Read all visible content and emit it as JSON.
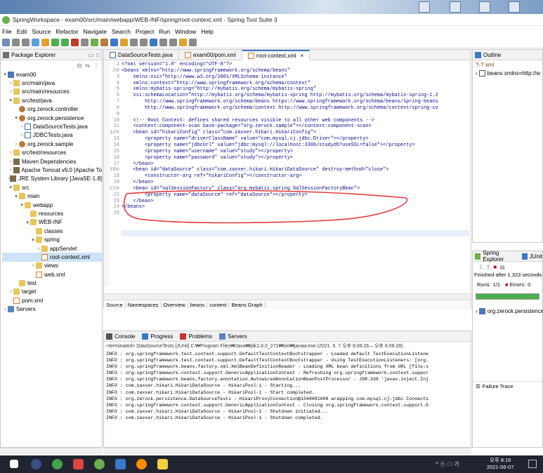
{
  "window": {
    "title": "SpringWorkspace - exam00/src/main/webapp/WEB-INF/spring/root-context.xml - Spring Tool Suite 3"
  },
  "menu": [
    "File",
    "Edit",
    "Source",
    "Refactor",
    "Navigate",
    "Search",
    "Project",
    "Run",
    "Window",
    "Help"
  ],
  "package_explorer": {
    "title": "Package Explorer",
    "tree": [
      {
        "label": "exam00",
        "indent": 0,
        "icon": "project-icon",
        "arrow": "v"
      },
      {
        "label": "src/main/java",
        "indent": 1,
        "icon": "folder-icon",
        "arrow": ">"
      },
      {
        "label": "src/main/resources",
        "indent": 1,
        "icon": "folder-icon",
        "arrow": ">"
      },
      {
        "label": "src/test/java",
        "indent": 1,
        "icon": "folder-icon",
        "arrow": "v"
      },
      {
        "label": "org.zerock.controller",
        "indent": 2,
        "icon": "package-icon",
        "arrow": ""
      },
      {
        "label": "org.zerock.persistence",
        "indent": 2,
        "icon": "package-icon",
        "arrow": "v"
      },
      {
        "label": "DataSourceTests.java",
        "indent": 3,
        "icon": "java-file-icon",
        "arrow": ">"
      },
      {
        "label": "JDBCTests.java",
        "indent": 3,
        "icon": "java-file-icon",
        "arrow": ">"
      },
      {
        "label": "org.zerock.sample",
        "indent": 2,
        "icon": "package-icon",
        "arrow": ">"
      },
      {
        "label": "src/test/resources",
        "indent": 1,
        "icon": "folder-icon",
        "arrow": ">"
      },
      {
        "label": "Maven Dependencies",
        "indent": 1,
        "icon": "library-icon",
        "arrow": ">"
      },
      {
        "label": "Apache Tomcat v9.0 [Apache To",
        "indent": 1,
        "icon": "library-icon",
        "arrow": ">"
      },
      {
        "label": "JRE System Library [JavaSE-1.8]",
        "indent": 1,
        "icon": "library-icon",
        "arrow": ">"
      },
      {
        "label": "src",
        "indent": 1,
        "icon": "folder-icon",
        "arrow": "v"
      },
      {
        "label": "main",
        "indent": 2,
        "icon": "folder-icon",
        "arrow": "v"
      },
      {
        "label": "webapp",
        "indent": 3,
        "icon": "folder-icon",
        "arrow": "v"
      },
      {
        "label": "resources",
        "indent": 4,
        "icon": "folder-icon",
        "arrow": ""
      },
      {
        "label": "WEB-INF",
        "indent": 4,
        "icon": "folder-icon",
        "arrow": "v"
      },
      {
        "label": "classes",
        "indent": 5,
        "icon": "folder-icon",
        "arrow": ""
      },
      {
        "label": "spring",
        "indent": 5,
        "icon": "folder-icon",
        "arrow": "v"
      },
      {
        "label": "appServlet",
        "indent": 6,
        "icon": "folder-icon",
        "arrow": ">"
      },
      {
        "label": "root-context.xml",
        "indent": 6,
        "icon": "xml-file-icon",
        "arrow": "",
        "selected": true
      },
      {
        "label": "views",
        "indent": 5,
        "icon": "folder-icon",
        "arrow": ">"
      },
      {
        "label": "web.xml",
        "indent": 5,
        "icon": "xml-file-icon",
        "arrow": ""
      },
      {
        "label": "test",
        "indent": 2,
        "icon": "folder-icon",
        "arrow": ""
      },
      {
        "label": "target",
        "indent": 1,
        "icon": "folder-icon",
        "arrow": ">"
      },
      {
        "label": "pom.xml",
        "indent": 1,
        "icon": "xml-file-icon",
        "arrow": ""
      },
      {
        "label": "Servers",
        "indent": 0,
        "icon": "server-icon",
        "arrow": ">"
      }
    ]
  },
  "editor": {
    "tabs": [
      {
        "label": "DataSourceTests.java",
        "active": false
      },
      {
        "label": "exam00/pom.xml",
        "active": false
      },
      {
        "label": "root-context.xml",
        "active": true
      }
    ],
    "line_numbers": "1\n2⊖\n3\n4\n5\n6\n7\n8\n9\n10\n11\n12⊖\n13\n14\n15\n16\n17\n18⊖\n19\n20\n21⊖\n22\n23\n24\n25",
    "code": "<?xml version=\"1.0\" encoding=\"UTF-8\"?>\n<beans xmlns=\"http://www.springframework.org/schema/beans\"\n    xmlns:xsi=\"http://www.w3.org/2001/XMLSchema-instance\"\n    xmlns:context=\"http://www.springframework.org/schema/context\"\n    xmlns:mybatis-spring=\"http://mybatis.org/schema/mybatis-spring\"\n    xsi:schemaLocation=\"http://mybatis.org/schema/mybatis-spring http://mybatis.org/schema/mybatis-spring-1.2\n        http://www.springframework.org/schema/beans https://www.springframework.org/schema/beans/spring-beans\n        http://www.springframework.org/schema/context http://www.springframework.org/schema/context/spring-co\n\n    <!-- Root Context: defines shared resources visible to all other web components -->\n    <context:component-scan base-package=\"org.zerock.sample\"></context:component-scan>\n    <bean id=\"hikariConfig\" class=\"com.zaxxer.hikari.HikariConfig\">\n        <property name=\"driverClassName\" value=\"com.mysql.cj.jdbc.Driver\"></property>\n        <property name=\"jdbcUrl\" value=\"jdbc:mysql://localhost:3306/studydb?useSSL=false\"></property>\n        <property name=\"username\" value=\"study\"></property>\n        <property name=\"password\" value=\"study\"></property>\n    </bean>\n    <bean id=\"dataSource\" class=\"com.zaxxer.hikari.HikariDataSource\" destroy-method=\"close\">\n        <constructor-arg ref=\"hikariConfig\"></constructor-arg>\n    </bean>\n    <bean id=\"sqlSessionFactory\" class=\"org.mybatis.spring.SqlSessionFactoryBean\">\n        <property name=\"dataSource\" ref=\"dataSource\"></property>\n    </bean>\n</beans>\n",
    "bottom_tabs": [
      "Source",
      "Namespaces",
      "Overview",
      "beans",
      "context",
      "Beans Graph"
    ]
  },
  "console": {
    "tabs": [
      "Console",
      "Progress",
      "Problems",
      "Servers"
    ],
    "terminated": "<terminated> DataSourceTests [JUnit] C:₩Program Files₩Java₩jdk1.8.0_271₩bin₩javaw.exe (2021. 6. 7 오후 8:06:26 – 오후 8:06:28)",
    "text": "INFO : org.springframework.test.context.support.DefaultTestContextBootstrapper - Loaded default TestExecutionListene\nINFO : org.springframework.test.context.support.DefaultTestContextBootstrapper - Using TestExecutionListeners: [org.\nINFO : org.springframework.beans.factory.xml.XmlBeanDefinitionReader - Loading XML bean definitions from URL [file:s\nINFO : org.springframework.context.support.GenericApplicationContext - Refreshing org.springframework.context.suppor\nINFO : org.springframework.beans.factory.annotation.AutowiredAnnotationBeanPostProcessor - JSR-330 'javax.inject.Inj\nINFO : com.zaxxer.hikari.HikariDataSource - HikariPool-1 - Starting...\nINFO : com.zaxxer.hikari.HikariDataSource - HikariPool-1 - Start completed.\nINFO : org.zerock.persistence.DataSourceTests - HikariProxyConnection@1548081008 wrapping com.mysql.cj.jdbc.Connecti\nINFO : org.springframework.context.support.GenericApplicationContext - Closing org.springframework.context.support.G\nINFO : com.zaxxer.hikari.HikariDataSource - HikariPool-1 - Shutdown initiated...\nINFO : com.zaxxer.hikari.HikariDataSource - HikariPool-1 - Shutdown completed."
  },
  "outline": {
    "title": "Outline",
    "items": [
      "?-? xml",
      "beans xmlns=http://w"
    ]
  },
  "junit": {
    "tabs": [
      "Spring Explorer",
      "JUnit"
    ],
    "finished": "Finished after 1.323 seconds",
    "runs_label": "Runs:",
    "runs_value": "1/1",
    "errors_label": "Errors:",
    "errors_value": "0",
    "progress": 1.0,
    "tree_item": "org.zerock.persistence",
    "failure_trace": "Failure Trace"
  },
  "taskbar": {
    "time": "오후 8:16",
    "date": "2021-06-07",
    "tray": "^ ⓔ ☁ 가"
  },
  "colors": {
    "accent": "#3b78c6",
    "success": "#4caf50",
    "annotation": "#e33b3b"
  }
}
